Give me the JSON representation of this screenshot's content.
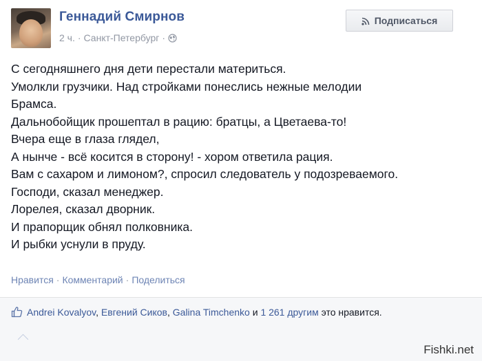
{
  "post": {
    "author": "Геннадий Смирнов",
    "time": "2 ч.",
    "dot": "·",
    "location": "Санкт-Петербург",
    "audience_icon": "globe-icon",
    "subscribe_label": "Подписаться",
    "subscribe_icon": "rss-icon",
    "lines": [
      "С сегодняшнего дня дети перестали материться.",
      "Умолкли грузчики. Над стройками понеслись нежные мелодии",
      "Брамса.",
      "Дальнобойщик прошептал в рацию: братцы, а Цветаева-то!",
      "Вчера еще в глаза глядел,",
      "А нынче - всё косится в сторону! - хором ответила рация.",
      "Вам с сахаром и лимоном?, спросил следователь у подозреваемого.",
      "Господи, сказал менеджер.",
      "Лорелея, сказал дворник.",
      "И прапорщик обнял полковника.",
      "И рыбки уснули в пруду."
    ]
  },
  "actions": {
    "like": "Нравится",
    "comment": "Комментарий",
    "share": "Поделиться",
    "sep": "·"
  },
  "likes": {
    "icon": "thumbs-up-icon",
    "name1": "Andrei Kovalyov",
    "sep1": ",",
    "name2": "Евгений Сиков",
    "sep2": ",",
    "name3": "Galina Timchenko",
    "and": "и",
    "others": "1 261 другим",
    "suffix": "это нравится."
  },
  "watermark": "Fishki.net",
  "colors": {
    "link": "#3b5998",
    "muted": "#9197a3",
    "action": "#6d84b4"
  }
}
